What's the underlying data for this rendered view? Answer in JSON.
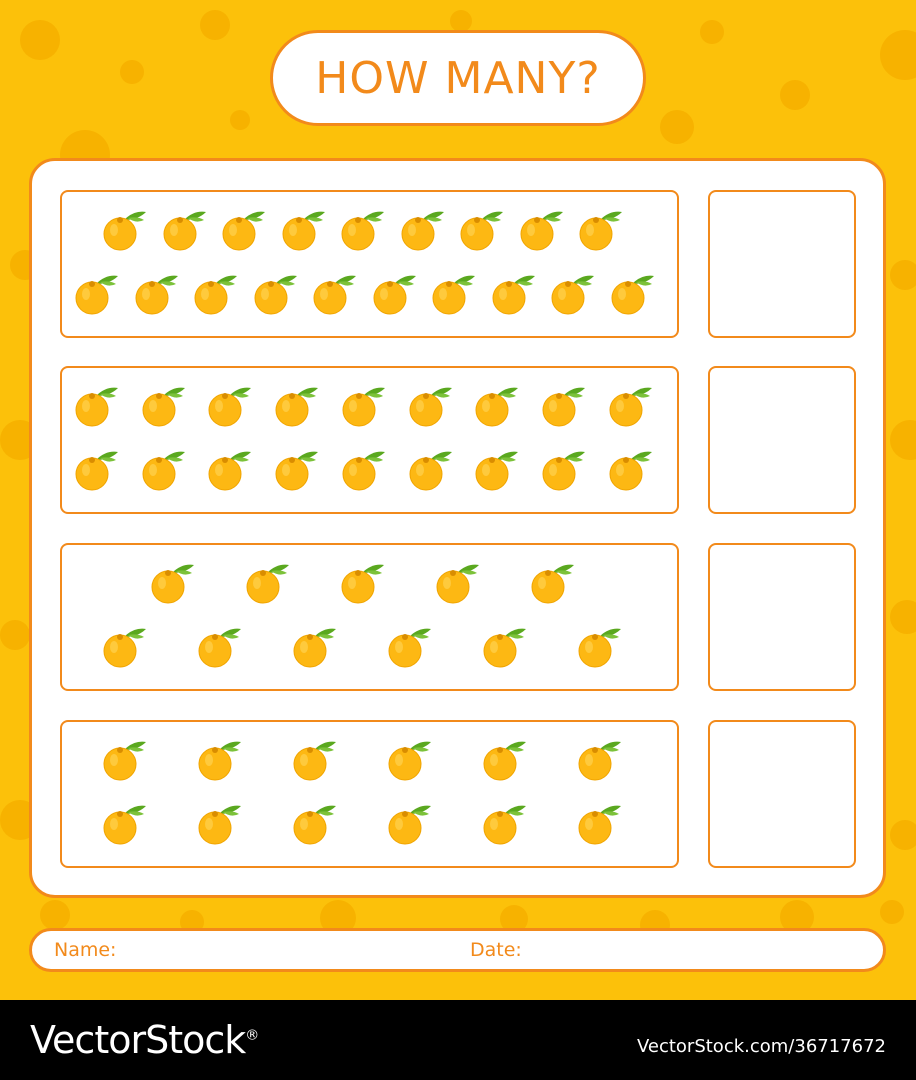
{
  "header": {
    "title": "HOW MANY?"
  },
  "rows": [
    {
      "fruit_icon": "orange-icon",
      "count": 19
    },
    {
      "fruit_icon": "orange-icon",
      "count": 18
    },
    {
      "fruit_icon": "orange-icon",
      "count": 11
    },
    {
      "fruit_icon": "orange-icon",
      "count": 12
    }
  ],
  "form": {
    "name_label": "Name:",
    "date_label": "Date:"
  },
  "footer": {
    "brand": "VectorStock",
    "brand_mark": "®",
    "url": "VectorStock.com/36717672"
  },
  "colors": {
    "background": "#fcc10a",
    "accent": "#f28a1b",
    "fruit": "#fdb813",
    "leaf": "#5aa81f"
  }
}
